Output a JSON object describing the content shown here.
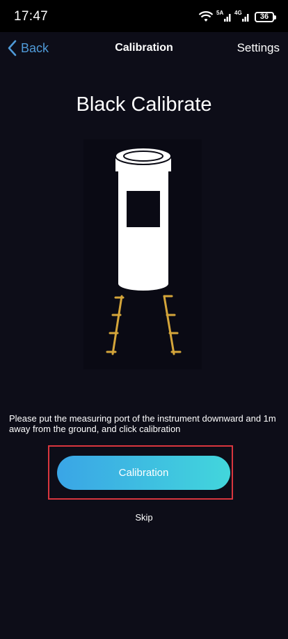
{
  "status_bar": {
    "time": "17:47",
    "signal_1_label": "5A",
    "signal_2_label": "4G",
    "battery_level": "36",
    "icons": [
      "wifi-icon",
      "signal-icon",
      "signal-icon",
      "battery-icon"
    ]
  },
  "nav": {
    "back_label": "Back",
    "title": "Calibration",
    "settings_label": "Settings",
    "back_icon": "chevron-left-icon"
  },
  "main": {
    "heading": "Black Calibrate",
    "illustration_icon": "instrument-illustration",
    "instruction": "Please put the measuring port of the instrument downward and 1m away from the ground, and click calibration",
    "calibration_button_label": "Calibration",
    "skip_label": "Skip"
  },
  "colors": {
    "background": "#0d0d18",
    "accent_link": "#4f9ad8",
    "button_gradient_start": "#3aa5e6",
    "button_gradient_end": "#42d6dc",
    "highlight_border": "#d9363e",
    "ruler_gold": "#d4a53a"
  }
}
